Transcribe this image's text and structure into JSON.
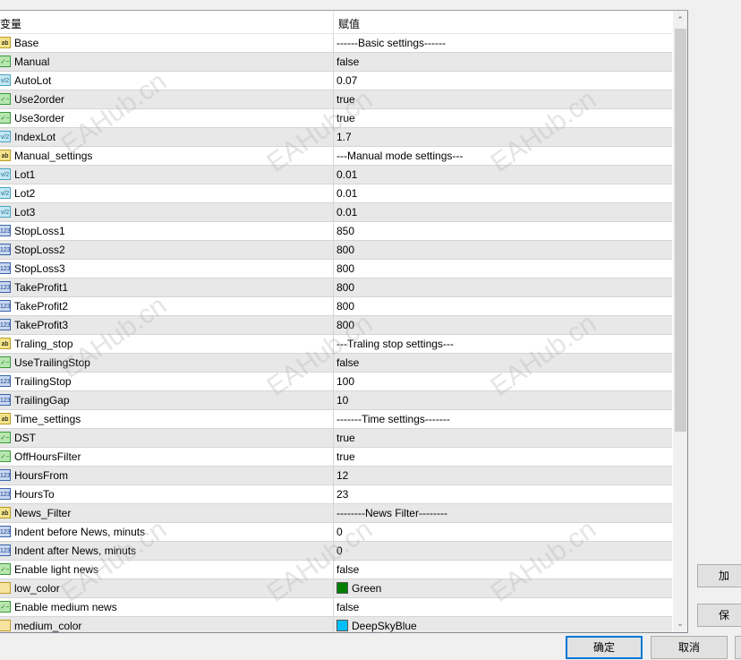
{
  "header": {
    "col_variable": "变量",
    "col_value": "赋值"
  },
  "rows": [
    {
      "name": "Base",
      "type": "string",
      "value": "------Basic settings------"
    },
    {
      "name": "Manual",
      "type": "bool",
      "value": "false"
    },
    {
      "name": "AutoLot",
      "type": "double",
      "value": "0.07"
    },
    {
      "name": "Use2order",
      "type": "bool",
      "value": "true"
    },
    {
      "name": "Use3order",
      "type": "bool",
      "value": "true"
    },
    {
      "name": "IndexLot",
      "type": "double",
      "value": "1.7"
    },
    {
      "name": "Manual_settings",
      "type": "string",
      "value": "---Manual mode settings---"
    },
    {
      "name": "Lot1",
      "type": "double",
      "value": "0.01"
    },
    {
      "name": "Lot2",
      "type": "double",
      "value": "0.01"
    },
    {
      "name": "Lot3",
      "type": "double",
      "value": "0.01"
    },
    {
      "name": "StopLoss1",
      "type": "int",
      "value": "850"
    },
    {
      "name": "StopLoss2",
      "type": "int",
      "value": "800"
    },
    {
      "name": "StopLoss3",
      "type": "int",
      "value": "800"
    },
    {
      "name": "TakeProfit1",
      "type": "int",
      "value": "800"
    },
    {
      "name": "TakeProfit2",
      "type": "int",
      "value": "800"
    },
    {
      "name": "TakeProfit3",
      "type": "int",
      "value": "800"
    },
    {
      "name": "Traling_stop",
      "type": "string",
      "value": "---Traling stop settings---"
    },
    {
      "name": "UseTrailingStop",
      "type": "bool",
      "value": "false"
    },
    {
      "name": "TrailingStop",
      "type": "int",
      "value": "100"
    },
    {
      "name": "TrailingGap",
      "type": "int",
      "value": "10"
    },
    {
      "name": "Time_settings",
      "type": "string",
      "value": "-------Time settings-------"
    },
    {
      "name": "DST",
      "type": "bool",
      "value": "true"
    },
    {
      "name": "OffHoursFilter",
      "type": "bool",
      "value": "true"
    },
    {
      "name": "HoursFrom",
      "type": "int",
      "value": "12"
    },
    {
      "name": "HoursTo",
      "type": "int",
      "value": "23"
    },
    {
      "name": "News_Filter",
      "type": "string",
      "value": "--------News Filter--------"
    },
    {
      "name": "Indent before News, minuts",
      "type": "int",
      "value": "0"
    },
    {
      "name": "Indent after News, minuts",
      "type": "int",
      "value": "0"
    },
    {
      "name": "Enable light news",
      "type": "bool",
      "value": "false"
    },
    {
      "name": "low_color",
      "type": "color",
      "value": "Green",
      "swatch": "#008000"
    },
    {
      "name": "Enable medium news",
      "type": "bool",
      "value": "false"
    },
    {
      "name": "medium_color",
      "type": "color",
      "value": "DeepSkyBlue",
      "swatch": "#00bfff"
    }
  ],
  "buttons": {
    "ok": "确定",
    "cancel": "取消",
    "load": "加",
    "save": "保"
  },
  "watermark": "EAHub.cn"
}
